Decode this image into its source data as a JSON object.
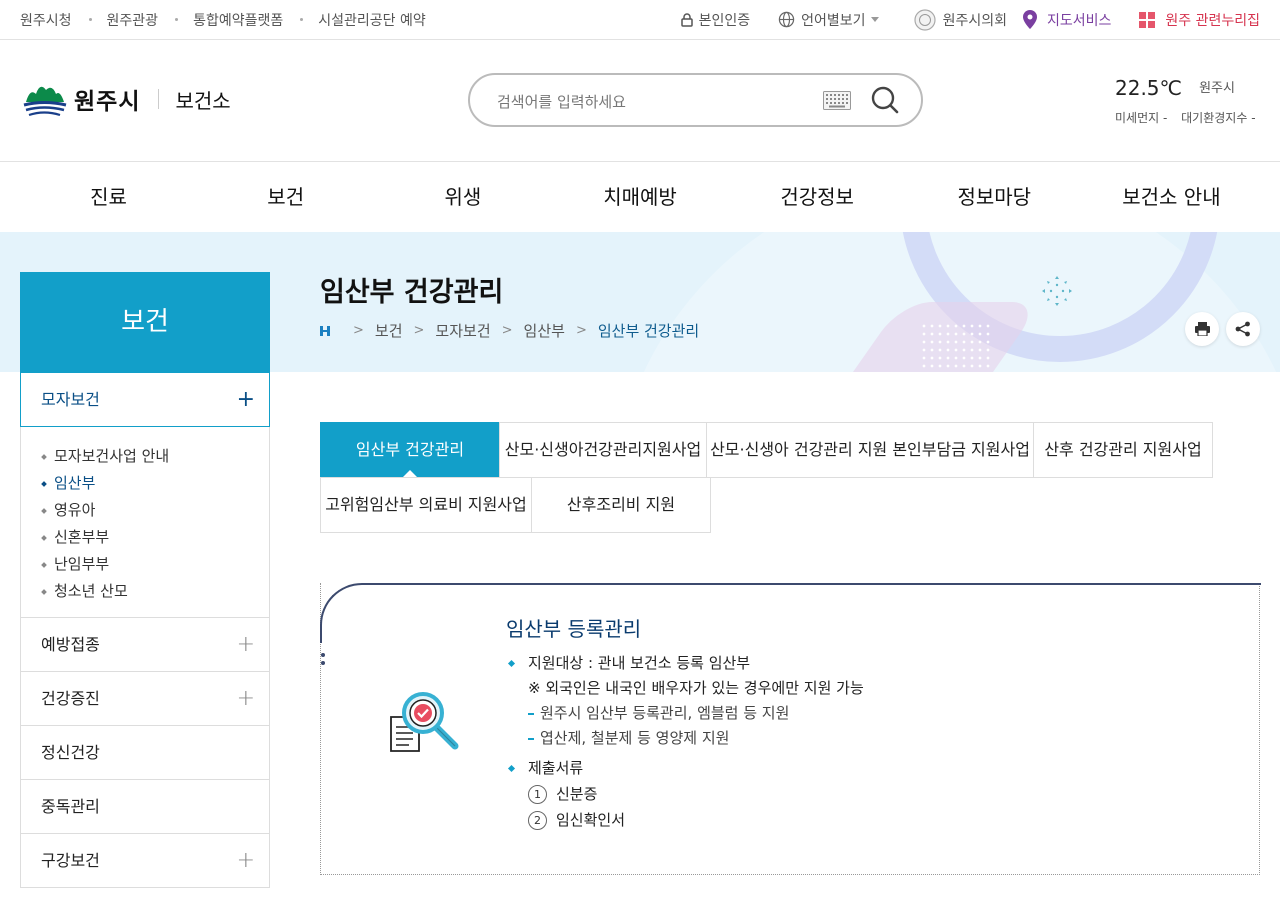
{
  "topbar": {
    "links": [
      "원주시청",
      "원주관광",
      "통합예약플랫폼",
      "시설관리공단 예약"
    ],
    "cert": "본인인증",
    "lang": "언어별보기",
    "council": "원주시의회",
    "map": "지도서비스",
    "related": "원주 관련누리집"
  },
  "header": {
    "logo_name": "원주시",
    "logo_sub": "보건소",
    "search_placeholder": "검색어를 입력하세요",
    "weather_temp": "22.5℃",
    "weather_loc": "원주시",
    "dust": "미세먼지 -",
    "air": "대기환경지수 -"
  },
  "gnb": [
    "진료",
    "보건",
    "위생",
    "치매예방",
    "건강정보",
    "정보마당",
    "보건소 안내"
  ],
  "page": {
    "title": "임산부 건강관리",
    "breadcrumb": [
      "보건",
      "모자보건",
      "임산부",
      "임산부 건강관리"
    ]
  },
  "lnb": {
    "title": "보건",
    "selected": "모자보건",
    "subitems": [
      "모자보건사업 안내",
      "임산부",
      "영유아",
      "신혼부부",
      "난임부부",
      "청소년 산모"
    ],
    "active_sub": "임산부",
    "menus": [
      {
        "label": "예방접종",
        "plus": "+"
      },
      {
        "label": "건강증진",
        "plus": "+"
      },
      {
        "label": "정신건강",
        "plus": ""
      },
      {
        "label": "중독관리",
        "plus": ""
      },
      {
        "label": "구강보건",
        "plus": "+"
      }
    ]
  },
  "tabs": [
    "임산부 건강관리",
    "산모·신생아건강관리지원사업",
    "산모·신생아 건강관리 지원 본인부담금 지원사업",
    "산후 건강관리 지원사업",
    "고위험임산부 의료비 지원사업",
    "산후조리비 지원"
  ],
  "content": {
    "title": "임산부 등록관리",
    "target": "지원대상 : 관내 보건소 등록 임산부",
    "note": "※ 외국인은 내국인 배우자가 있는 경우에만 지원 가능",
    "details": [
      "원주시 임산부 등록관리, 엠블럼 등 지원",
      "엽산제, 철분제 등 영양제 지원"
    ],
    "docs_title": "제출서류",
    "docs": [
      {
        "n": "1",
        "label": "신분증"
      },
      {
        "n": "2",
        "label": "임신확인서"
      }
    ]
  },
  "colors": {
    "primary": "#129fc9",
    "navy": "#0a3b6e",
    "map": "#7a3fa0",
    "related": "#d6344f"
  }
}
